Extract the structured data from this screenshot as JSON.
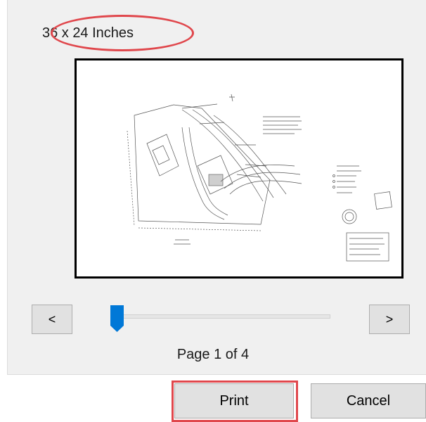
{
  "dialog": {
    "paper_size": "36 x 24 Inches",
    "pager": {
      "prev_label": "<",
      "next_label": ">",
      "page_text": "Page 1 of 4"
    },
    "buttons": {
      "print_label": "Print",
      "cancel_label": "Cancel"
    },
    "colors": {
      "highlight": "#e0474c",
      "slider_thumb": "#0078d7",
      "panel_background": "#f0f0f0",
      "button_background": "#e1e1e1"
    },
    "icons": {
      "prev": "chevron-left-icon",
      "next": "chevron-right-icon"
    }
  }
}
